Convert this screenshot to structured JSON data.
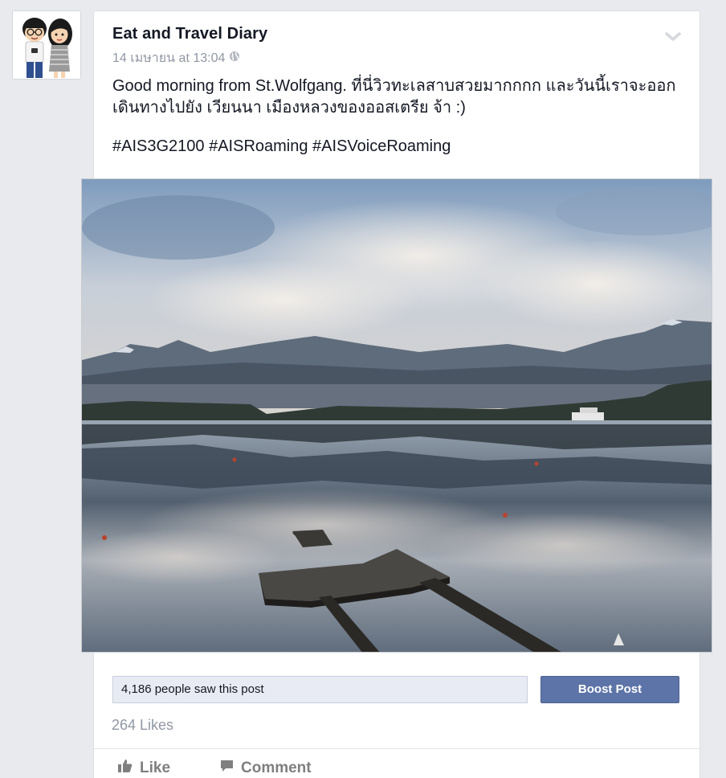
{
  "post": {
    "author": "Eat and Travel Diary",
    "timestamp": "14 เมษายน at 13:04",
    "audience_icon": "globe-icon",
    "menu_icon": "chevron-down-icon",
    "text_line": "Good morning from St.Wolfgang. ที่นี่วิวทะเลสาบสวยมากกกก และวันนี้เราจะออกเดินทางไปยัง เวียนนา เมืองหลวงของออสเตรีย จ้า :)",
    "hashtags": "#AIS3G2100 #AISRoaming #AISVoiceRoaming",
    "image_icon": "lake-landscape-photo"
  },
  "insights": {
    "reach_text": "4,186 people saw this post",
    "boost_label": "Boost Post",
    "likes_text": "264 Likes"
  },
  "actions": {
    "like_label": "Like",
    "comment_label": "Comment",
    "like_icon": "thumbs-up-icon",
    "comment_icon": "comment-bubble-icon"
  },
  "colors": {
    "background": "#e9eaed",
    "boost_button": "#5d74a8",
    "reach_box": "#e9ebf4",
    "muted_text": "#9197a3"
  }
}
